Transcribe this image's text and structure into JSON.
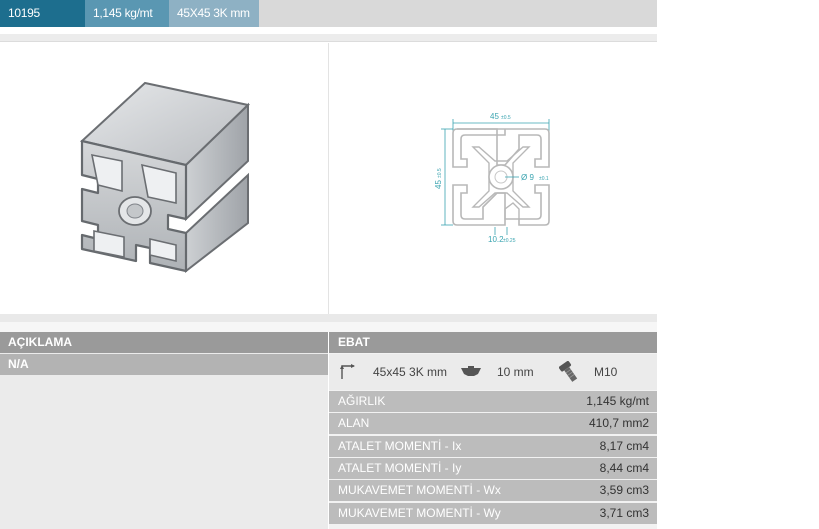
{
  "header": {
    "product_id": "10195",
    "weight": "1,145 kg/mt",
    "dimension": "45X45 3K mm"
  },
  "drawing": {
    "width_label": "45",
    "width_tol": "±0.5",
    "height_label": "45",
    "height_tol": "±0.5",
    "bore_label": "Ø 9",
    "bore_tol": "±0.1",
    "slot_label": "10.2",
    "slot_tol": "±0.25"
  },
  "description": {
    "header": "AÇIKLAMA",
    "value": "N/A"
  },
  "dimensions": {
    "header": "EBAT",
    "size": "45x45 3K mm",
    "slot": "10 mm",
    "bolt": "M10"
  },
  "properties": [
    {
      "label": "AĞIRLIK",
      "value": "1,145 kg/mt"
    },
    {
      "label": "ALAN",
      "value": "410,7 mm2"
    },
    {
      "label": "ATALET MOMENTİ - Ix",
      "value": "8,17 cm4"
    },
    {
      "label": "ATALET MOMENTİ - Iy",
      "value": "8,44 cm4"
    },
    {
      "label": "MUKAVEMET MOMENTİ - Wx",
      "value": "3,59 cm3"
    },
    {
      "label": "MUKAVEMET MOMENTİ - Wy",
      "value": "3,71 cm3"
    }
  ],
  "colors": {
    "tab_dark": "#1d6e8e",
    "tab_mid": "#5a97b2",
    "tab_light": "#8eb1c4",
    "dim_teal": "#3aa4b0"
  },
  "icons": [
    "dimension-arrows-icon",
    "t-nut-icon",
    "bolt-icon"
  ]
}
